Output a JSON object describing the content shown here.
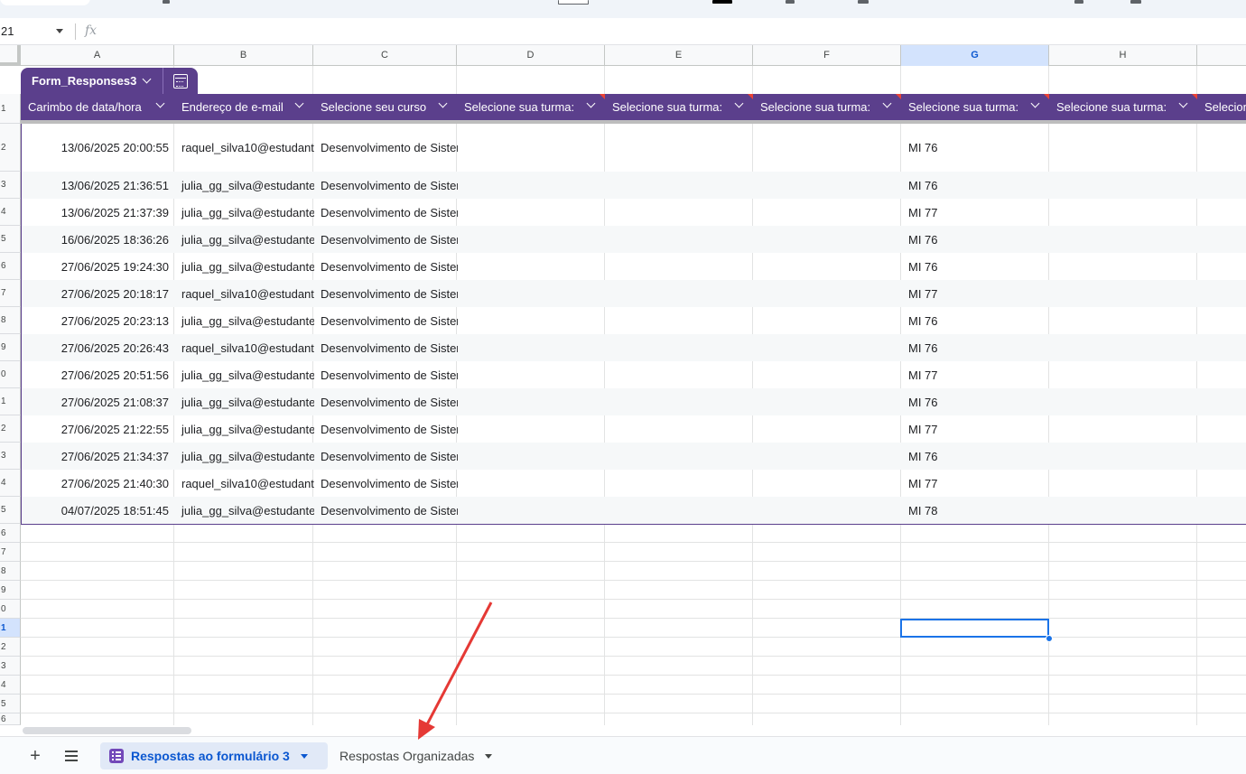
{
  "formula_bar": {
    "name_box": "21",
    "fx_icon": "fx-icon"
  },
  "columns": [
    "A",
    "B",
    "C",
    "D",
    "E",
    "F",
    "G",
    "H"
  ],
  "selected_column": "G",
  "row_numbers": [
    "1",
    "2",
    "3",
    "4",
    "5",
    "6",
    "7",
    "8",
    "9",
    "0",
    "1",
    "2",
    "3",
    "4",
    "5",
    "6",
    "7",
    "8",
    "9",
    "0",
    "1",
    "2",
    "3",
    "4",
    "5",
    "6"
  ],
  "selected_row_label": "1",
  "table": {
    "name": "Form_Responses3",
    "headers": [
      "Carimbo de data/hora",
      "Endereço de e-mail",
      "Selecione seu curso",
      "Selecione sua turma:",
      "Selecione sua turma:",
      "Selecione sua turma:",
      "Selecione sua turma:",
      "Selecione sua turma:",
      "Selecion"
    ],
    "rows": [
      [
        "13/06/2025 20:00:55",
        "raquel_silva10@estudante",
        "Desenvolvimento de Sistemas",
        "",
        "",
        "",
        "MI 76",
        ""
      ],
      [
        "13/06/2025 21:36:51",
        "julia_gg_silva@estudante",
        "Desenvolvimento de Sistemas",
        "",
        "",
        "",
        "MI 76",
        ""
      ],
      [
        "13/06/2025 21:37:39",
        "julia_gg_silva@estudante",
        "Desenvolvimento de Sistemas",
        "",
        "",
        "",
        "MI 77",
        ""
      ],
      [
        "16/06/2025 18:36:26",
        "julia_gg_silva@estudante",
        "Desenvolvimento de Sistemas",
        "",
        "",
        "",
        "MI 76",
        ""
      ],
      [
        "27/06/2025 19:24:30",
        "julia_gg_silva@estudante",
        "Desenvolvimento de Sistemas",
        "",
        "",
        "",
        "MI 76",
        ""
      ],
      [
        "27/06/2025 20:18:17",
        "raquel_silva10@estudante",
        "Desenvolvimento de Sistemas",
        "",
        "",
        "",
        "MI 77",
        ""
      ],
      [
        "27/06/2025 20:23:13",
        "julia_gg_silva@estudante",
        "Desenvolvimento de Sistemas",
        "",
        "",
        "",
        "MI 76",
        ""
      ],
      [
        "27/06/2025 20:26:43",
        "raquel_silva10@estudante",
        "Desenvolvimento de Sistemas",
        "",
        "",
        "",
        "MI 76",
        ""
      ],
      [
        "27/06/2025 20:51:56",
        "julia_gg_silva@estudante",
        "Desenvolvimento de Sistemas",
        "",
        "",
        "",
        "MI 77",
        ""
      ],
      [
        "27/06/2025 21:08:37",
        "julia_gg_silva@estudante",
        "Desenvolvimento de Sistemas",
        "",
        "",
        "",
        "MI 76",
        ""
      ],
      [
        "27/06/2025 21:22:55",
        "julia_gg_silva@estudante",
        "Desenvolvimento de Sistemas",
        "",
        "",
        "",
        "MI 77",
        ""
      ],
      [
        "27/06/2025 21:34:37",
        "julia_gg_silva@estudante",
        "Desenvolvimento de Sistemas",
        "",
        "",
        "",
        "MI 76",
        ""
      ],
      [
        "27/06/2025 21:40:30",
        "raquel_silva10@estudante",
        "Desenvolvimento de Sistemas",
        "",
        "",
        "",
        "MI 77",
        ""
      ],
      [
        "04/07/2025 18:51:45",
        "julia_gg_silva@estudante",
        "Desenvolvimento de Sistemas",
        "",
        "",
        "",
        "MI 78",
        ""
      ]
    ]
  },
  "sheet_tabs": {
    "add_icon": "plus-icon",
    "list_icon": "menu-icon",
    "active": "Respostas ao formulário 3",
    "inactive": "Respostas Organizadas"
  },
  "colors": {
    "table_header": "#5b3f8c",
    "selection": "#1a73e8",
    "annotation_arrow": "#e53935"
  }
}
